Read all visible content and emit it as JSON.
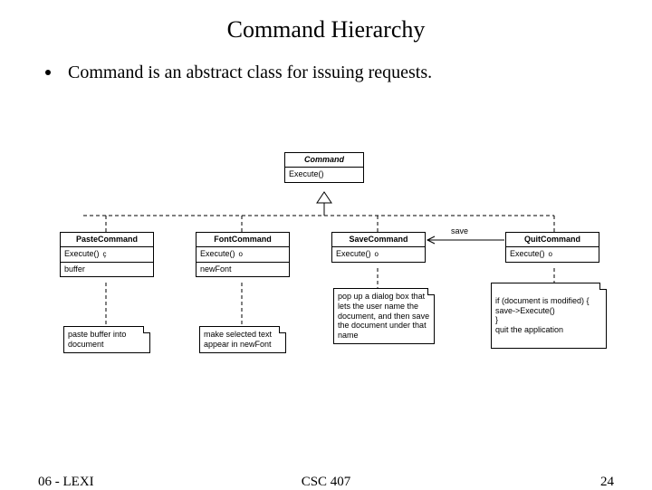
{
  "title": "Command Hierarchy",
  "bullet": "Command is an abstract class for issuing requests.",
  "footer": {
    "left": "06 - LEXI",
    "center": "CSC 407",
    "right": "24"
  },
  "diagram": {
    "base": {
      "name": "Command",
      "op": "Execute()"
    },
    "save_label": "save",
    "subs": {
      "paste": {
        "name": "PasteCommand",
        "op": "Execute()",
        "attr": "buffer"
      },
      "font": {
        "name": "FontCommand",
        "op": "Execute()",
        "attr": "newFont"
      },
      "savec": {
        "name": "SaveCommand",
        "op": "Execute()"
      },
      "quit": {
        "name": "QuitCommand",
        "op": "Execute()"
      }
    },
    "notes": {
      "paste": "paste buffer into document",
      "font": "make selected text appear in newFont",
      "savec": "pop up a dialog box that lets the user name the document, and then save the document under that name",
      "quit": "if (document is modified) {\n  save->Execute()\n}\nquit the application"
    }
  }
}
